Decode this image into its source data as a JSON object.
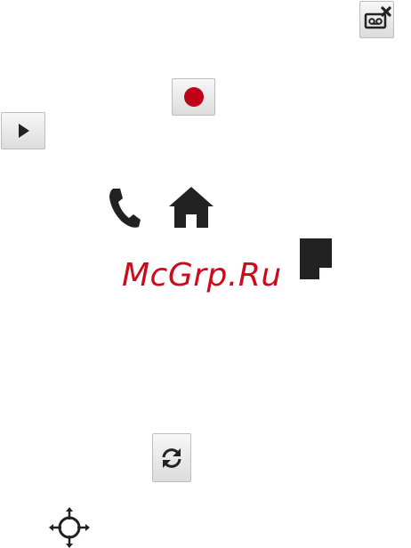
{
  "watermark": {
    "text": "McGrp.Ru",
    "color": "#cc0c1c"
  },
  "colors": {
    "record_dot": "#c00018",
    "icon_dark": "#222222",
    "button_border": "#bdbdbd"
  },
  "controls": [
    {
      "id": "voicemail-delete",
      "icon": "voicemail-delete-icon"
    },
    {
      "id": "record",
      "icon": "record-icon"
    },
    {
      "id": "play",
      "icon": "play-icon"
    },
    {
      "id": "call",
      "icon": "phone-icon"
    },
    {
      "id": "home",
      "icon": "home-icon"
    },
    {
      "id": "note",
      "icon": "note-icon"
    },
    {
      "id": "refresh",
      "icon": "refresh-icon"
    },
    {
      "id": "locate",
      "icon": "crosshair-icon"
    }
  ]
}
